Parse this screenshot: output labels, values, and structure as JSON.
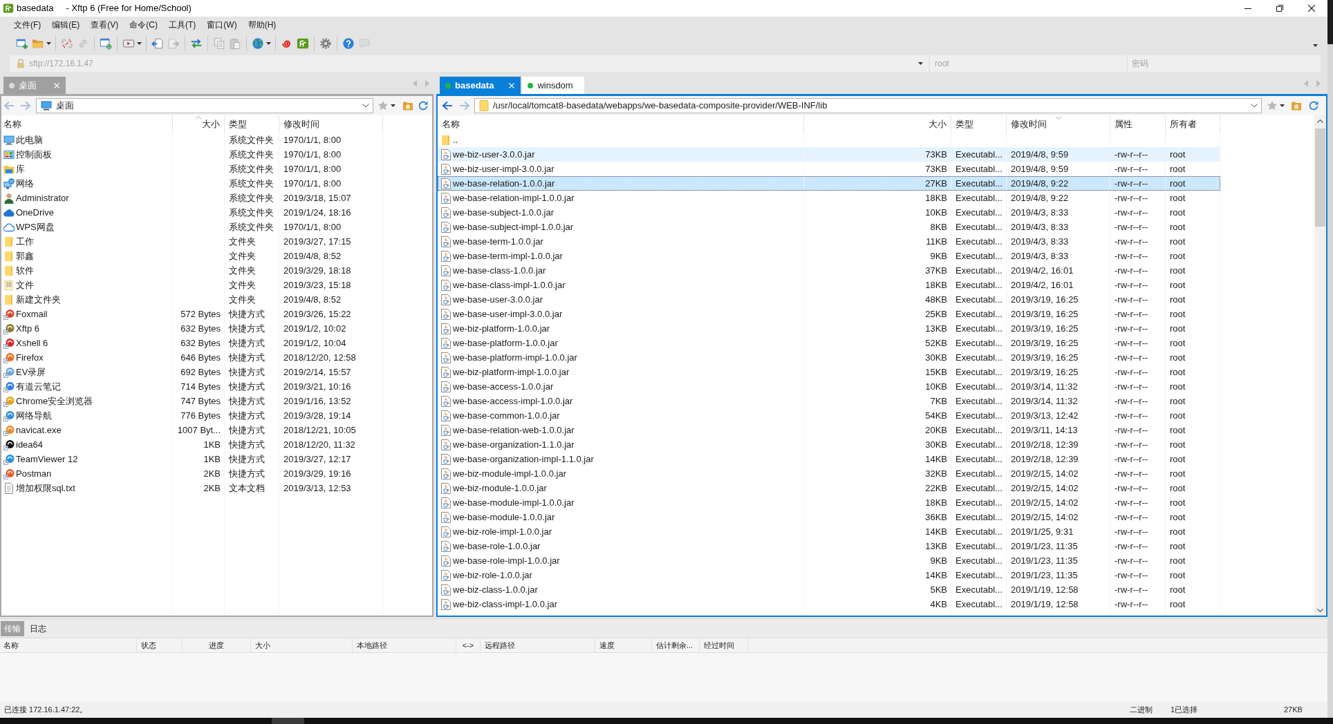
{
  "window": {
    "title": "basedata",
    "app_title": "- Xftp 6 (Free for Home/School)"
  },
  "menu": [
    "文件(F)",
    "编辑(E)",
    "查看(V)",
    "命令(C)",
    "工具(T)",
    "窗口(W)",
    "帮助(H)"
  ],
  "toolbar": [
    {
      "kind": "window-plus",
      "disabled": false
    },
    {
      "kind": "folder",
      "disabled": false
    },
    {
      "kind": "dropdown-caret"
    },
    {
      "kind": "separator"
    },
    {
      "kind": "broken-chain",
      "disabled": false
    },
    {
      "kind": "chain",
      "disabled": true
    },
    {
      "kind": "separator"
    },
    {
      "kind": "window-gear",
      "disabled": false
    },
    {
      "kind": "separator"
    },
    {
      "kind": "play-box",
      "disabled": false
    },
    {
      "kind": "dropdown-caret"
    },
    {
      "kind": "separator"
    },
    {
      "kind": "arrow-box-left",
      "disabled": false
    },
    {
      "kind": "arrow-box-right",
      "disabled": true
    },
    {
      "kind": "separator"
    },
    {
      "kind": "swap-arrows",
      "disabled": false
    },
    {
      "kind": "separator"
    },
    {
      "kind": "copy",
      "disabled": true
    },
    {
      "kind": "paste",
      "disabled": true
    },
    {
      "kind": "separator"
    },
    {
      "kind": "globe",
      "disabled": false
    },
    {
      "kind": "dropdown-caret"
    },
    {
      "kind": "separator"
    },
    {
      "kind": "swirl",
      "disabled": false
    },
    {
      "kind": "app-logo",
      "disabled": false
    },
    {
      "kind": "separator"
    },
    {
      "kind": "gear",
      "disabled": false
    },
    {
      "kind": "separator"
    },
    {
      "kind": "help",
      "disabled": false
    },
    {
      "kind": "chat",
      "disabled": true
    }
  ],
  "address": {
    "placeholder": "sftp://172.16.1.47"
  },
  "username": {
    "placeholder": "root"
  },
  "password": {
    "placeholder": "密码"
  },
  "panes": [
    {
      "active": false,
      "tabs": [
        {
          "label": "桌面",
          "selected": true,
          "color": "#dcdcdc"
        }
      ],
      "back": {
        "disabled": true
      },
      "forward": {
        "disabled": true
      },
      "path": {
        "kind": "desktop",
        "text": "桌面"
      },
      "columns": [
        {
          "label": "名称",
          "sort_ascending": false,
          "sort_descending": false
        },
        {
          "label": "大小",
          "sort_ascending": true,
          "sort_descending": false
        },
        {
          "label": "类型",
          "sort_ascending": false,
          "sort_descending": false
        },
        {
          "label": "修改时间",
          "sort_ascending": false,
          "sort_descending": false
        }
      ],
      "rows": [
        {
          "kind": "computer",
          "name": "此电脑",
          "type": "系统文件夹",
          "modified": "1970/1/1, 8:00"
        },
        {
          "kind": "control-panel",
          "name": "控制面板",
          "type": "系统文件夹",
          "modified": "1970/1/1, 8:00"
        },
        {
          "kind": "library",
          "name": "库",
          "type": "系统文件夹",
          "modified": "1970/1/1, 8:00"
        },
        {
          "kind": "network",
          "name": "网络",
          "type": "系统文件夹",
          "modified": "1970/1/1, 8:00"
        },
        {
          "kind": "user",
          "name": "Administrator",
          "type": "系统文件夹",
          "modified": "2019/3/18, 15:07"
        },
        {
          "kind": "cloud",
          "name": "OneDrive",
          "type": "系统文件夹",
          "modified": "2019/1/24, 18:16"
        },
        {
          "kind": "cloud-outline",
          "name": "WPS网盘",
          "type": "系统文件夹",
          "modified": "1970/1/1, 8:00"
        },
        {
          "kind": "folder",
          "name": "工作",
          "type": "文件夹",
          "modified": "2019/3/27, 17:15"
        },
        {
          "kind": "folder",
          "name": "郭鑫",
          "type": "文件夹",
          "modified": "2019/4/8, 8:52"
        },
        {
          "kind": "folder",
          "name": "软件",
          "type": "文件夹",
          "modified": "2019/3/29, 18:18"
        },
        {
          "kind": "folder-grid",
          "name": "文件",
          "type": "文件夹",
          "modified": "2019/3/23, 15:18"
        },
        {
          "kind": "folder",
          "name": "新建文件夹",
          "type": "文件夹",
          "modified": "2019/4/8, 8:52"
        },
        {
          "kind": "shortcut",
          "color": "#e2452f",
          "name": "Foxmail",
          "size": "572 Bytes",
          "type": "快捷方式",
          "modified": "2019/3/26, 15:22"
        },
        {
          "kind": "shortcut",
          "color": "#8a7a2a",
          "name": "Xftp 6",
          "size": "632 Bytes",
          "type": "快捷方式",
          "modified": "2019/1/2, 10:02"
        },
        {
          "kind": "shortcut",
          "color": "#d9262b",
          "name": "Xshell 6",
          "size": "632 Bytes",
          "type": "快捷方式",
          "modified": "2019/1/2, 10:04"
        },
        {
          "kind": "shortcut",
          "color": "#f26b1d",
          "name": "Firefox",
          "size": "646 Bytes",
          "type": "快捷方式",
          "modified": "2018/12/20, 12:58"
        },
        {
          "kind": "shortcut",
          "color": "#6fa8dc",
          "name": "EV录屏",
          "size": "692 Bytes",
          "type": "快捷方式",
          "modified": "2019/2/14, 15:57"
        },
        {
          "kind": "shortcut",
          "color": "#2f7de1",
          "name": "有道云笔记",
          "size": "714 Bytes",
          "type": "快捷方式",
          "modified": "2019/3/21, 10:16"
        },
        {
          "kind": "shortcut",
          "color": "#e8a317",
          "name": "Chrome安全浏览器",
          "size": "747 Bytes",
          "type": "快捷方式",
          "modified": "2019/1/16, 13:52"
        },
        {
          "kind": "shortcut",
          "color": "#2b8de6",
          "name": "网络导航",
          "size": "776 Bytes",
          "type": "快捷方式",
          "modified": "2019/3/28, 19:14"
        },
        {
          "kind": "shortcut",
          "color": "#f08a24",
          "name": "navicat.exe",
          "size": "1007 Byt...",
          "type": "快捷方式",
          "modified": "2018/12/21, 10:05"
        },
        {
          "kind": "shortcut",
          "color": "#111111",
          "name": "idea64",
          "size": "1KB",
          "type": "快捷方式",
          "modified": "2018/12/20, 11:32"
        },
        {
          "kind": "shortcut",
          "color": "#1e8fe6",
          "name": "TeamViewer 12",
          "size": "1KB",
          "type": "快捷方式",
          "modified": "2019/3/27, 12:17"
        },
        {
          "kind": "shortcut",
          "color": "#ef5b25",
          "name": "Postman",
          "size": "2KB",
          "type": "快捷方式",
          "modified": "2019/3/29, 19:16"
        },
        {
          "kind": "text",
          "name": "增加权限sql.txt",
          "size": "2KB",
          "type": "文本文档",
          "modified": "2019/3/13, 12:53"
        }
      ]
    },
    {
      "active": true,
      "tabs": [
        {
          "label": "basedata",
          "selected": true,
          "color": "#1db93a"
        },
        {
          "label": "winsdom",
          "selected": false,
          "color": "#1db93a"
        }
      ],
      "back": {
        "disabled": false
      },
      "forward": {
        "disabled": true
      },
      "path": {
        "kind": "folder",
        "text": "/usr/local/tomcat8-basedata/webapps/we-basedata-composite-provider/WEB-INF/lib"
      },
      "columns": [
        {
          "label": "名称",
          "sort_ascending": false,
          "sort_descending": false
        },
        {
          "label": "大小",
          "sort_ascending": false,
          "sort_descending": false
        },
        {
          "label": "类型",
          "sort_ascending": false,
          "sort_descending": false
        },
        {
          "label": "修改时间",
          "sort_ascending": false,
          "sort_descending": true
        },
        {
          "label": "属性",
          "sort_ascending": false,
          "sort_descending": false
        },
        {
          "label": "所有者",
          "sort_ascending": false,
          "sort_descending": false
        }
      ],
      "rows": [
        {
          "kind": "parent-folder",
          "name": "..",
          "selected": false,
          "hovered": false
        },
        {
          "kind": "jar",
          "name": "we-biz-user-3.0.0.jar",
          "size": "73KB",
          "type": "Executabl...",
          "modified": "2019/4/8, 9:59",
          "attributes": "-rw-r--r--",
          "owner": "root",
          "selected": false,
          "hovered": true
        },
        {
          "kind": "jar",
          "name": "we-biz-user-impl-3.0.0.jar",
          "size": "73KB",
          "type": "Executabl...",
          "modified": "2019/4/8, 9:59",
          "attributes": "-rw-r--r--",
          "owner": "root",
          "selected": false,
          "hovered": false
        },
        {
          "kind": "jar",
          "name": "we-base-relation-1.0.0.jar",
          "size": "27KB",
          "type": "Executabl...",
          "modified": "2019/4/8, 9:22",
          "attributes": "-rw-r--r--",
          "owner": "root",
          "selected": true,
          "hovered": false
        },
        {
          "kind": "jar",
          "name": "we-base-relation-impl-1.0.0.jar",
          "size": "18KB",
          "type": "Executabl...",
          "modified": "2019/4/8, 9:22",
          "attributes": "-rw-r--r--",
          "owner": "root",
          "selected": false,
          "hovered": false
        },
        {
          "kind": "jar",
          "name": "we-base-subject-1.0.0.jar",
          "size": "10KB",
          "type": "Executabl...",
          "modified": "2019/4/3, 8:33",
          "attributes": "-rw-r--r--",
          "owner": "root",
          "selected": false,
          "hovered": false
        },
        {
          "kind": "jar",
          "name": "we-base-subject-impl-1.0.0.jar",
          "size": "8KB",
          "type": "Executabl...",
          "modified": "2019/4/3, 8:33",
          "attributes": "-rw-r--r--",
          "owner": "root",
          "selected": false,
          "hovered": false
        },
        {
          "kind": "jar",
          "name": "we-base-term-1.0.0.jar",
          "size": "11KB",
          "type": "Executabl...",
          "modified": "2019/4/3, 8:33",
          "attributes": "-rw-r--r--",
          "owner": "root",
          "selected": false,
          "hovered": false
        },
        {
          "kind": "jar",
          "name": "we-base-term-impl-1.0.0.jar",
          "size": "9KB",
          "type": "Executabl...",
          "modified": "2019/4/3, 8:33",
          "attributes": "-rw-r--r--",
          "owner": "root",
          "selected": false,
          "hovered": false
        },
        {
          "kind": "jar",
          "name": "we-base-class-1.0.0.jar",
          "size": "37KB",
          "type": "Executabl...",
          "modified": "2019/4/2, 16:01",
          "attributes": "-rw-r--r--",
          "owner": "root",
          "selected": false,
          "hovered": false
        },
        {
          "kind": "jar",
          "name": "we-base-class-impl-1.0.0.jar",
          "size": "18KB",
          "type": "Executabl...",
          "modified": "2019/4/2, 16:01",
          "attributes": "-rw-r--r--",
          "owner": "root",
          "selected": false,
          "hovered": false
        },
        {
          "kind": "jar",
          "name": "we-base-user-3.0.0.jar",
          "size": "48KB",
          "type": "Executabl...",
          "modified": "2019/3/19, 16:25",
          "attributes": "-rw-r--r--",
          "owner": "root",
          "selected": false,
          "hovered": false
        },
        {
          "kind": "jar",
          "name": "we-base-user-impl-3.0.0.jar",
          "size": "25KB",
          "type": "Executabl...",
          "modified": "2019/3/19, 16:25",
          "attributes": "-rw-r--r--",
          "owner": "root",
          "selected": false,
          "hovered": false
        },
        {
          "kind": "jar",
          "name": "we-biz-platform-1.0.0.jar",
          "size": "13KB",
          "type": "Executabl...",
          "modified": "2019/3/19, 16:25",
          "attributes": "-rw-r--r--",
          "owner": "root",
          "selected": false,
          "hovered": false
        },
        {
          "kind": "jar",
          "name": "we-base-platform-1.0.0.jar",
          "size": "52KB",
          "type": "Executabl...",
          "modified": "2019/3/19, 16:25",
          "attributes": "-rw-r--r--",
          "owner": "root",
          "selected": false,
          "hovered": false
        },
        {
          "kind": "jar",
          "name": "we-base-platform-impl-1.0.0.jar",
          "size": "30KB",
          "type": "Executabl...",
          "modified": "2019/3/19, 16:25",
          "attributes": "-rw-r--r--",
          "owner": "root",
          "selected": false,
          "hovered": false
        },
        {
          "kind": "jar",
          "name": "we-biz-platform-impl-1.0.0.jar",
          "size": "15KB",
          "type": "Executabl...",
          "modified": "2019/3/19, 16:25",
          "attributes": "-rw-r--r--",
          "owner": "root",
          "selected": false,
          "hovered": false
        },
        {
          "kind": "jar",
          "name": "we-base-access-1.0.0.jar",
          "size": "10KB",
          "type": "Executabl...",
          "modified": "2019/3/14, 11:32",
          "attributes": "-rw-r--r--",
          "owner": "root",
          "selected": false,
          "hovered": false
        },
        {
          "kind": "jar",
          "name": "we-base-access-impl-1.0.0.jar",
          "size": "7KB",
          "type": "Executabl...",
          "modified": "2019/3/14, 11:32",
          "attributes": "-rw-r--r--",
          "owner": "root",
          "selected": false,
          "hovered": false
        },
        {
          "kind": "jar",
          "name": "we-base-common-1.0.0.jar",
          "size": "54KB",
          "type": "Executabl...",
          "modified": "2019/3/13, 12:42",
          "attributes": "-rw-r--r--",
          "owner": "root",
          "selected": false,
          "hovered": false
        },
        {
          "kind": "jar",
          "name": "we-base-relation-web-1.0.0.jar",
          "size": "20KB",
          "type": "Executabl...",
          "modified": "2019/3/11, 14:13",
          "attributes": "-rw-r--r--",
          "owner": "root",
          "selected": false,
          "hovered": false
        },
        {
          "kind": "jar",
          "name": "we-base-organization-1.1.0.jar",
          "size": "30KB",
          "type": "Executabl...",
          "modified": "2019/2/18, 12:39",
          "attributes": "-rw-r--r--",
          "owner": "root",
          "selected": false,
          "hovered": false
        },
        {
          "kind": "jar",
          "name": "we-base-organization-impl-1.1.0.jar",
          "size": "14KB",
          "type": "Executabl...",
          "modified": "2019/2/18, 12:39",
          "attributes": "-rw-r--r--",
          "owner": "root",
          "selected": false,
          "hovered": false
        },
        {
          "kind": "jar",
          "name": "we-biz-module-impl-1.0.0.jar",
          "size": "32KB",
          "type": "Executabl...",
          "modified": "2019/2/15, 14:02",
          "attributes": "-rw-r--r--",
          "owner": "root",
          "selected": false,
          "hovered": false
        },
        {
          "kind": "jar",
          "name": "we-biz-module-1.0.0.jar",
          "size": "22KB",
          "type": "Executabl...",
          "modified": "2019/2/15, 14:02",
          "attributes": "-rw-r--r--",
          "owner": "root",
          "selected": false,
          "hovered": false
        },
        {
          "kind": "jar",
          "name": "we-base-module-impl-1.0.0.jar",
          "size": "18KB",
          "type": "Executabl...",
          "modified": "2019/2/15, 14:02",
          "attributes": "-rw-r--r--",
          "owner": "root",
          "selected": false,
          "hovered": false
        },
        {
          "kind": "jar",
          "name": "we-base-module-1.0.0.jar",
          "size": "36KB",
          "type": "Executabl...",
          "modified": "2019/2/15, 14:02",
          "attributes": "-rw-r--r--",
          "owner": "root",
          "selected": false,
          "hovered": false
        },
        {
          "kind": "jar",
          "name": "we-biz-role-impl-1.0.0.jar",
          "size": "14KB",
          "type": "Executabl...",
          "modified": "2019/1/25, 9:31",
          "attributes": "-rw-r--r--",
          "owner": "root",
          "selected": false,
          "hovered": false
        },
        {
          "kind": "jar",
          "name": "we-base-role-1.0.0.jar",
          "size": "13KB",
          "type": "Executabl...",
          "modified": "2019/1/23, 11:35",
          "attributes": "-rw-r--r--",
          "owner": "root",
          "selected": false,
          "hovered": false
        },
        {
          "kind": "jar",
          "name": "we-base-role-impl-1.0.0.jar",
          "size": "9KB",
          "type": "Executabl...",
          "modified": "2019/1/23, 11:35",
          "attributes": "-rw-r--r--",
          "owner": "root",
          "selected": false,
          "hovered": false
        },
        {
          "kind": "jar",
          "name": "we-biz-role-1.0.0.jar",
          "size": "14KB",
          "type": "Executabl...",
          "modified": "2019/1/23, 11:35",
          "attributes": "-rw-r--r--",
          "owner": "root",
          "selected": false,
          "hovered": false
        },
        {
          "kind": "jar",
          "name": "we-biz-class-1.0.0.jar",
          "size": "5KB",
          "type": "Executabl...",
          "modified": "2019/1/19, 12:58",
          "attributes": "-rw-r--r--",
          "owner": "root",
          "selected": false,
          "hovered": false
        },
        {
          "kind": "jar",
          "name": "we-biz-class-impl-1.0.0.jar",
          "size": "4KB",
          "type": "Executabl...",
          "modified": "2019/1/19, 12:58",
          "attributes": "-rw-r--r--",
          "owner": "root",
          "selected": false,
          "hovered": false
        }
      ]
    }
  ],
  "transfer": {
    "tabs": [
      {
        "label": "传输",
        "selected": true
      },
      {
        "label": "日志",
        "selected": false
      }
    ],
    "columns": [
      "名称",
      "状态",
      "进度",
      "大小",
      "本地路径",
      "<->",
      "远程路径",
      "速度",
      "估计剩余...",
      "经过时间"
    ]
  },
  "status_bar": {
    "connection": "已连接 172.16.1.47:22。",
    "transfer_mode": "二进制",
    "selection": "1已选择",
    "size": "27KB"
  }
}
